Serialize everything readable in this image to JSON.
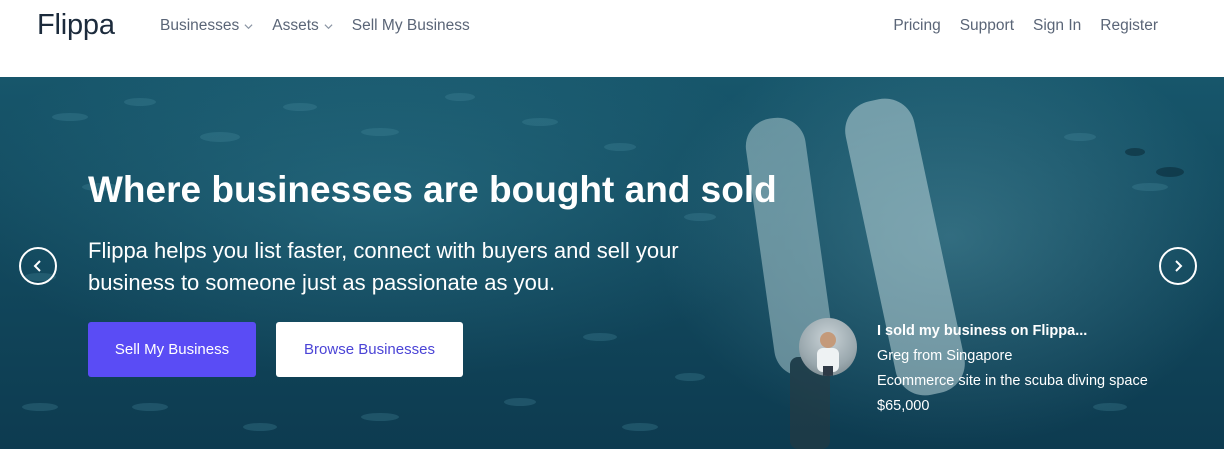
{
  "nav": {
    "logo": "Flippa",
    "left_items": [
      {
        "label": "Businesses",
        "has_dropdown": true
      },
      {
        "label": "Assets",
        "has_dropdown": true
      },
      {
        "label": "Sell My Business",
        "has_dropdown": false
      }
    ],
    "right_items": [
      {
        "label": "Pricing"
      },
      {
        "label": "Support"
      },
      {
        "label": "Sign In"
      },
      {
        "label": "Register"
      }
    ]
  },
  "hero": {
    "headline": "Where businesses are bought and sold",
    "subheadline": "Flippa helps you list faster, connect with buyers and sell your business to someone just as passionate as you.",
    "primary_button": "Sell My Business",
    "secondary_button": "Browse Businesses",
    "prev_icon": "chevron-left-icon",
    "next_icon": "chevron-right-icon"
  },
  "testimonial": {
    "title": "I sold my business on Flippa...",
    "name": "Greg from Singapore",
    "description": "Ecommerce site in the scuba diving space",
    "price": "$65,000"
  },
  "colors": {
    "primary_button": "#5a4cf5",
    "secondary_button_text": "#4b44d6",
    "nav_text": "#5a6577",
    "logo": "#1c2b3c",
    "hero_bg": "#12495e"
  }
}
